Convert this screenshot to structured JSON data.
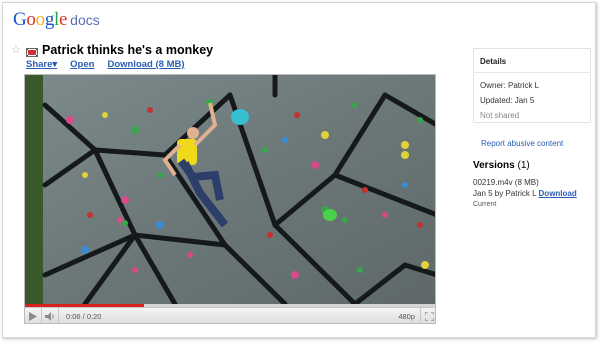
{
  "app": {
    "logo_text": "Google",
    "product": "docs"
  },
  "document": {
    "title": "Patrick thinks he's a monkey"
  },
  "actions": {
    "share": "Share▾",
    "open": "Open",
    "download": "Download (8 MB)"
  },
  "player": {
    "progress": 0.29,
    "time": "0:06 / 0:20",
    "quality": "480p",
    "accent_color": "#d6241c"
  },
  "details": {
    "header": "Details",
    "owner": "Owner: Patrick L",
    "updated": "Updated: Jan 5",
    "sharing": "Not shared"
  },
  "report_link": "Report abusive content",
  "versions": {
    "title": "Versions",
    "count": "(1)",
    "filename": "00219.m4v (8 MB)",
    "date_by": "Jan 5 by Patrick L",
    "download": "Download",
    "status": "Current"
  },
  "icons": [
    "star-icon",
    "video-file-icon",
    "play-icon",
    "volume-icon",
    "fullscreen-icon"
  ]
}
